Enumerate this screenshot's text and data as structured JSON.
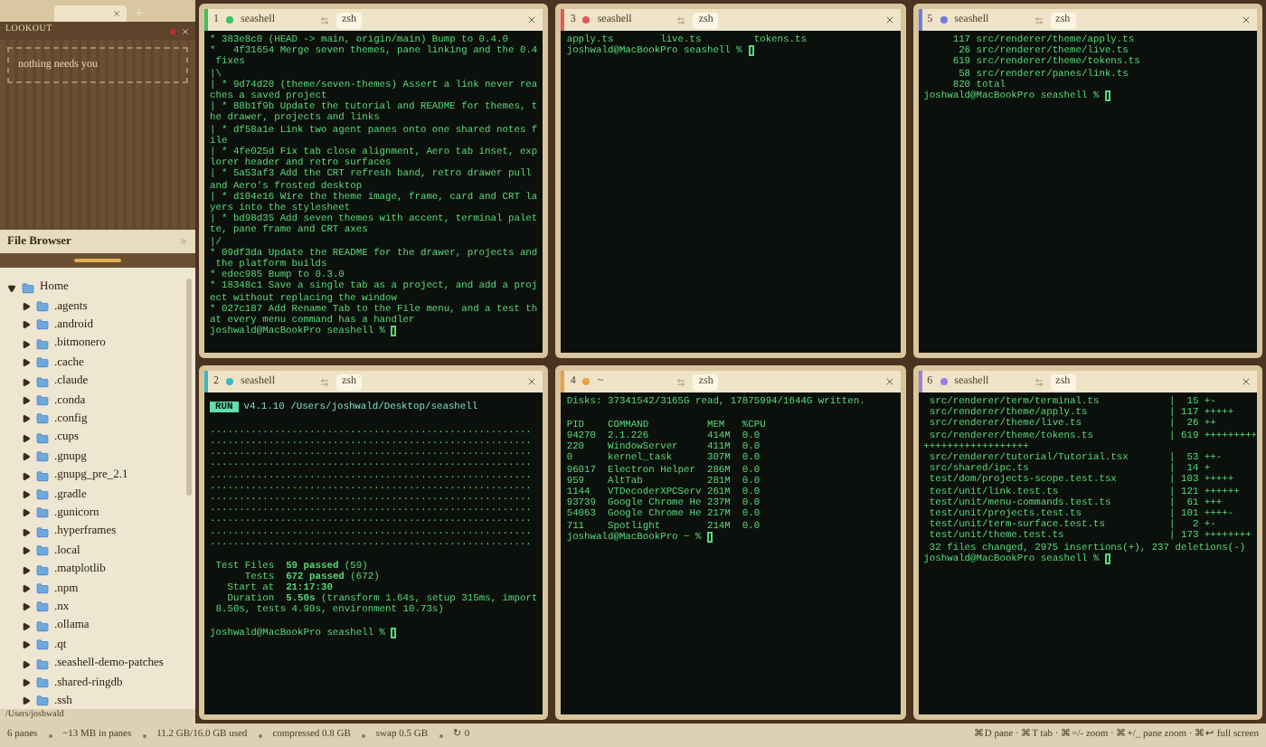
{
  "sidebar": {
    "lookout": {
      "title": "LOOKOUT",
      "note": "nothing needs you"
    },
    "file_browser": {
      "title": "File Browser",
      "tree": [
        {
          "label": "Home",
          "expanded": true,
          "children": [
            {
              "label": ".agents",
              "expanded": false
            },
            {
              "label": ".android",
              "expanded": false
            },
            {
              "label": ".bitmonero",
              "expanded": false
            },
            {
              "label": ".cache",
              "expanded": false
            },
            {
              "label": ".claude",
              "expanded": false
            },
            {
              "label": ".conda",
              "expanded": false
            },
            {
              "label": ".config",
              "expanded": false
            },
            {
              "label": ".cups",
              "expanded": false
            },
            {
              "label": ".gnupg",
              "expanded": false
            },
            {
              "label": ".gnupg_pre_2.1",
              "expanded": false
            },
            {
              "label": ".gradle",
              "expanded": false
            },
            {
              "label": ".gunicorn",
              "expanded": false
            },
            {
              "label": ".hyperframes",
              "expanded": false
            },
            {
              "label": ".local",
              "expanded": false
            },
            {
              "label": ".matplotlib",
              "expanded": false
            },
            {
              "label": ".npm",
              "expanded": false
            },
            {
              "label": ".nx",
              "expanded": false
            },
            {
              "label": ".ollama",
              "expanded": false
            },
            {
              "label": ".qt",
              "expanded": false
            },
            {
              "label": ".seashell-demo-patches",
              "expanded": false
            },
            {
              "label": ".shared-ringdb",
              "expanded": false
            },
            {
              "label": ".ssh",
              "expanded": false
            }
          ]
        }
      ],
      "path": "/Users/joshwald"
    }
  },
  "panes": [
    {
      "number": "1",
      "color": "#3fbf5f",
      "title": "seashell",
      "shell": "zsh",
      "blocks": [
        [
          "* 383e8c0 (HEAD -> main, origin/main) Bump to 0.4.0",
          "*   4f31654 Merge seven themes, pane linking and the 0.4",
          " fixes",
          "|\\",
          "| * 9d74d20 (theme/seven-themes) Assert a link never rea",
          "ches a saved project",
          "| * 88b1f9b Update the tutorial and README for themes, t",
          "he drawer, projects and links",
          "| * df58a1e Link two agent panes onto one shared notes f",
          "ile",
          "| * 4fe025d Fix tab close alignment, Aero tab inset, exp",
          "lorer header and retro surfaces",
          "| * 5a53af3 Add the CRT refresh band, retro drawer pull ",
          "and Aero's frosted desktop",
          "| * d104e16 Wire the theme image, frame, card and CRT la",
          "yers into the stylesheet",
          "| * bd98d35 Add seven themes with accent, terminal palet",
          "te, pane frame and CRT axes",
          "|/",
          "* 09df3da Update the README for the drawer, projects and",
          " the platform builds",
          "* edec985 Bump to 0.3.0",
          "* 18348c1 Save a single tab as a project, and add a proj",
          "ect without replacing the window",
          "* 027c187 Add Rename Tab to the File menu, and a test th",
          "at every menu command has a handler"
        ]
      ],
      "prompt": "joshwald@MacBookPro seashell % "
    },
    {
      "number": "2",
      "color": "#3bb6c8",
      "title": "seashell",
      "shell": "zsh",
      "run": {
        "badge": "RUN",
        "text": "v4.1.10 /Users/joshwald/Desktop/seashell"
      },
      "blocks": [
        [
          ".......................................................",
          ".......................................................",
          ".......................................................",
          ".......................................................",
          ".......................................................",
          ".......................................................",
          ".......................................................",
          ".......................................................",
          ".......................................................",
          ".......................................................",
          "......................................................."
        ],
        [
          " Test Files  **59 passed** (59)",
          "      Tests  **672 passed** (672)",
          "   Start at  **21:17:30**",
          "   Duration  **5.50s** (transform 1.64s, setup 315ms, import",
          " 8.50s, tests 4.90s, environment 10.73s)"
        ]
      ],
      "prompt": "joshwald@MacBookPro seashell % "
    },
    {
      "number": "3",
      "color": "#e05a5a",
      "title": "seashell",
      "shell": "zsh",
      "blocks": [
        [
          "apply.ts        live.ts         tokens.ts"
        ]
      ],
      "prompt": "joshwald@MacBookPro seashell % "
    },
    {
      "number": "4",
      "color": "#e8a040",
      "title": "~",
      "shell": "zsh",
      "blocks": [
        [
          "Disks: 37341542/3165G read, 17875994/1644G written."
        ],
        [
          "PID    COMMAND          MEM   %CPU",
          "94270  2.1.226          414M  0.0",
          "220    WindowServer     411M  0.0",
          "0      kernel_task      307M  0.0",
          "96017  Electron Helper  286M  0.0",
          "959    AltTab           281M  0.0",
          "1144   VTDecoderXPCServ 261M  0.0",
          "93739  Google Chrome He 237M  0.0",
          "54063  Google Chrome He 217M  0.0",
          "711    Spotlight        214M  0.0"
        ]
      ],
      "prompt": "joshwald@MacBookPro ~ % "
    },
    {
      "number": "5",
      "color": "#6a7fe0",
      "title": "seashell",
      "shell": "zsh",
      "blocks": [
        [
          "     117 src/renderer/theme/apply.ts",
          "      26 src/renderer/theme/live.ts",
          "     619 src/renderer/theme/tokens.ts",
          "      58 src/renderer/panes/link.ts",
          "     820 total"
        ]
      ],
      "prompt": "joshwald@MacBookPro seashell % "
    },
    {
      "number": "6",
      "color": "#a07ae0",
      "title": "seashell",
      "shell": "zsh",
      "blocks": [
        [
          " src/renderer/term/terminal.ts            |  15 +-",
          " src/renderer/theme/apply.ts              | 117 +++++",
          " src/renderer/theme/live.ts               |  26 ++",
          " src/renderer/theme/tokens.ts             | 619 +++++++++",
          "++++++++++++++++++",
          " src/renderer/tutorial/Tutorial.tsx       |  53 ++-",
          " src/shared/ipc.ts                        |  14 +",
          " test/dom/projects-scope.test.tsx         | 103 +++++",
          " test/unit/link.test.ts                   | 121 ++++++",
          " test/unit/menu-commands.test.ts          |  61 +++",
          " test/unit/projects.test.ts               | 101 ++++-",
          " test/unit/term-surface.test.ts           |   2 +-",
          " test/unit/theme.test.ts                  | 173 ++++++++",
          " 32 files changed, 2975 insertions(+), 237 deletions(-)"
        ]
      ],
      "prompt": "joshwald@MacBookPro seashell % "
    }
  ],
  "status_bar": {
    "items": [
      "6 panes",
      "~13 MB in panes",
      "11.2 GB/16.0 GB used",
      "compressed 0.8 GB",
      "swap 0.5 GB",
      "↻ 0"
    ],
    "hints": "⌘D pane · ⌘T tab · ⌘=/- zoom · ⌘+/_ pane zoom · ⌘↩ full screen"
  }
}
